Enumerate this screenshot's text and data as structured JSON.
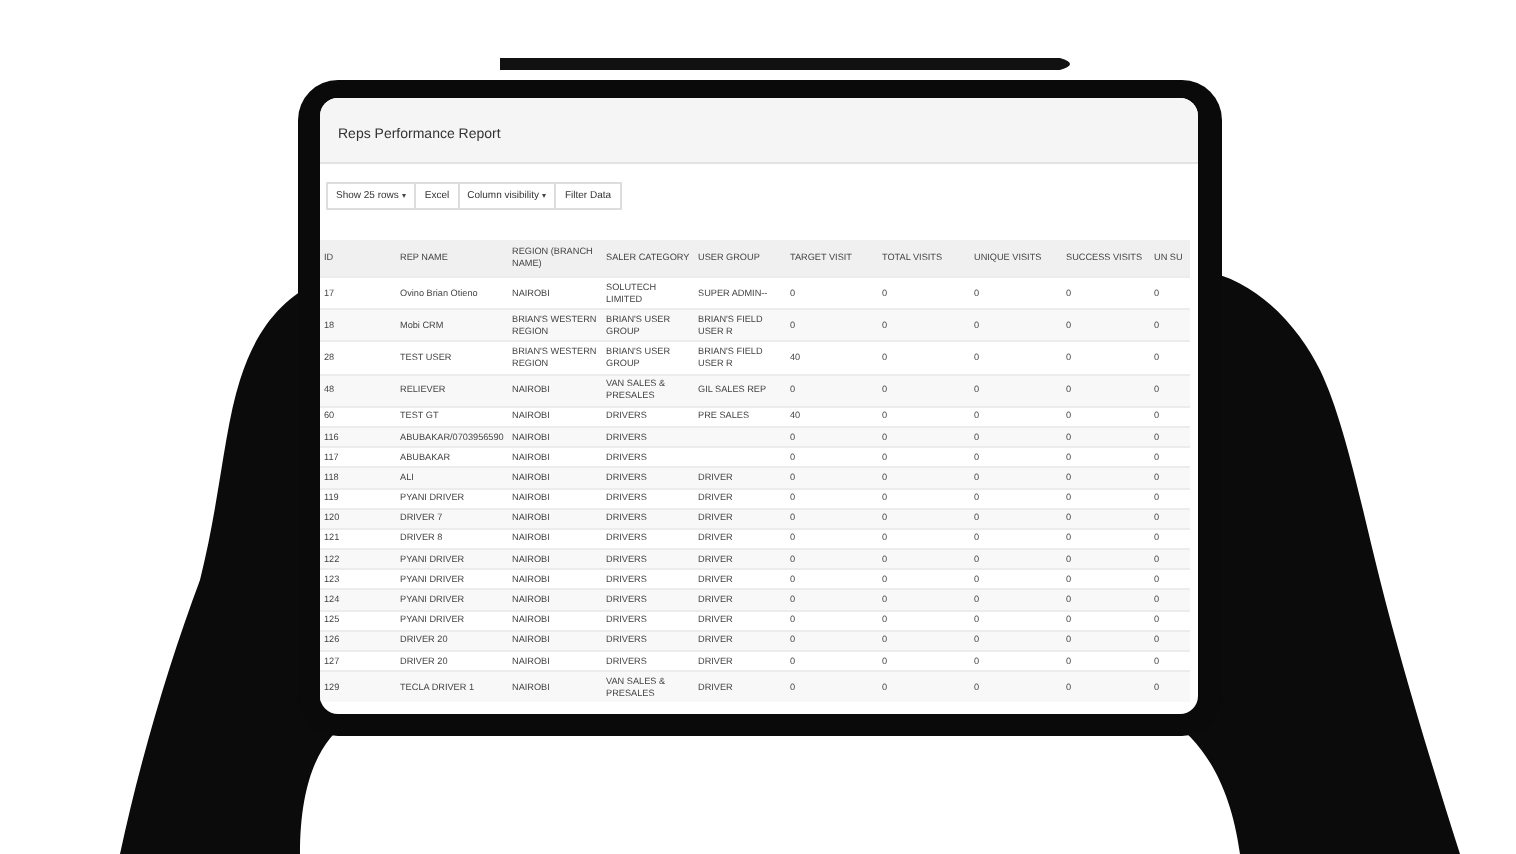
{
  "report": {
    "title": "Reps Performance Report"
  },
  "toolbar": [
    {
      "label": "Show 25 rows",
      "dropdown": true
    },
    {
      "label": "Excel",
      "dropdown": false
    },
    {
      "label": "Column visibility",
      "dropdown": true
    },
    {
      "label": "Filter Data",
      "dropdown": false
    }
  ],
  "table": {
    "columns": [
      "ID",
      "REP NAME",
      "REGION (BRANCH NAME)",
      "SALER CATEGORY",
      "USER GROUP",
      "TARGET VISIT",
      "TOTAL VISITS",
      "UNIQUE VISITS",
      "SUCCESS VISITS",
      "UN SU"
    ],
    "rows": [
      {
        "cells": [
          "17",
          "Ovino Brian Otieno",
          "NAIROBI",
          "SOLUTECH LIMITED",
          "SUPER ADMIN--",
          "0",
          "0",
          "0",
          "0",
          "0"
        ]
      },
      {
        "cells": [
          "18",
          "Mobi CRM",
          "BRIAN'S WESTERN REGION",
          "BRIAN'S USER GROUP",
          "BRIAN'S FIELD USER R",
          "0",
          "0",
          "0",
          "0",
          "0"
        ]
      },
      {
        "cells": [
          "28",
          "TEST USER",
          "BRIAN'S WESTERN REGION",
          "BRIAN'S USER GROUP",
          "BRIAN'S FIELD USER R",
          "40",
          "0",
          "0",
          "0",
          "0"
        ]
      },
      {
        "cells": [
          "48",
          "RELIEVER",
          "NAIROBI",
          "VAN SALES & PRESALES",
          "GIL SALES REP",
          "0",
          "0",
          "0",
          "0",
          "0"
        ]
      },
      {
        "cells": [
          "60",
          "TEST GT",
          "NAIROBI",
          "DRIVERS",
          "PRE SALES",
          "40",
          "0",
          "0",
          "0",
          "0"
        ]
      },
      {
        "cells": [
          "116",
          "ABUBAKAR/0703956590",
          "NAIROBI",
          "DRIVERS",
          null,
          "0",
          "0",
          "0",
          "0",
          "0"
        ]
      },
      {
        "cells": [
          "117",
          "ABUBAKAR",
          "NAIROBI",
          "DRIVERS",
          null,
          "0",
          "0",
          "0",
          "0",
          "0"
        ]
      },
      {
        "cells": [
          "118",
          "ALI",
          "NAIROBI",
          "DRIVERS",
          "DRIVER",
          "0",
          "0",
          "0",
          "0",
          "0"
        ]
      },
      {
        "cells": [
          "119",
          "PYANI DRIVER",
          "NAIROBI",
          "DRIVERS",
          "DRIVER",
          "0",
          "0",
          "0",
          "0",
          "0"
        ]
      },
      {
        "cells": [
          "120",
          "DRIVER 7",
          "NAIROBI",
          "DRIVERS",
          "DRIVER",
          "0",
          "0",
          "0",
          "0",
          "0"
        ]
      },
      {
        "cells": [
          "121",
          "DRIVER 8",
          "NAIROBI",
          "DRIVERS",
          "DRIVER",
          "0",
          "0",
          "0",
          "0",
          "0"
        ]
      },
      {
        "cells": [
          "122",
          "PYANI DRIVER",
          "NAIROBI",
          "DRIVERS",
          "DRIVER",
          "0",
          "0",
          "0",
          "0",
          "0"
        ]
      },
      {
        "cells": [
          "123",
          "PYANI DRIVER",
          "NAIROBI",
          "DRIVERS",
          "DRIVER",
          "0",
          "0",
          "0",
          "0",
          "0"
        ]
      },
      {
        "cells": [
          "124",
          "PYANI DRIVER",
          "NAIROBI",
          "DRIVERS",
          "DRIVER",
          "0",
          "0",
          "0",
          "0",
          "0"
        ]
      },
      {
        "cells": [
          "125",
          "PYANI DRIVER",
          "NAIROBI",
          "DRIVERS",
          "DRIVER",
          "0",
          "0",
          "0",
          "0",
          "0"
        ]
      },
      {
        "cells": [
          "126",
          "DRIVER 20",
          "NAIROBI",
          "DRIVERS",
          "DRIVER",
          "0",
          "0",
          "0",
          "0",
          "0"
        ]
      },
      {
        "cells": [
          "127",
          "DRIVER 20",
          "NAIROBI",
          "DRIVERS",
          "DRIVER",
          "0",
          "0",
          "0",
          "0",
          "0"
        ]
      },
      {
        "cells": [
          "129",
          "TECLA DRIVER 1",
          "NAIROBI",
          "VAN SALES & PRESALES",
          "DRIVER",
          "0",
          "0",
          "0",
          "0",
          "0"
        ]
      }
    ]
  }
}
